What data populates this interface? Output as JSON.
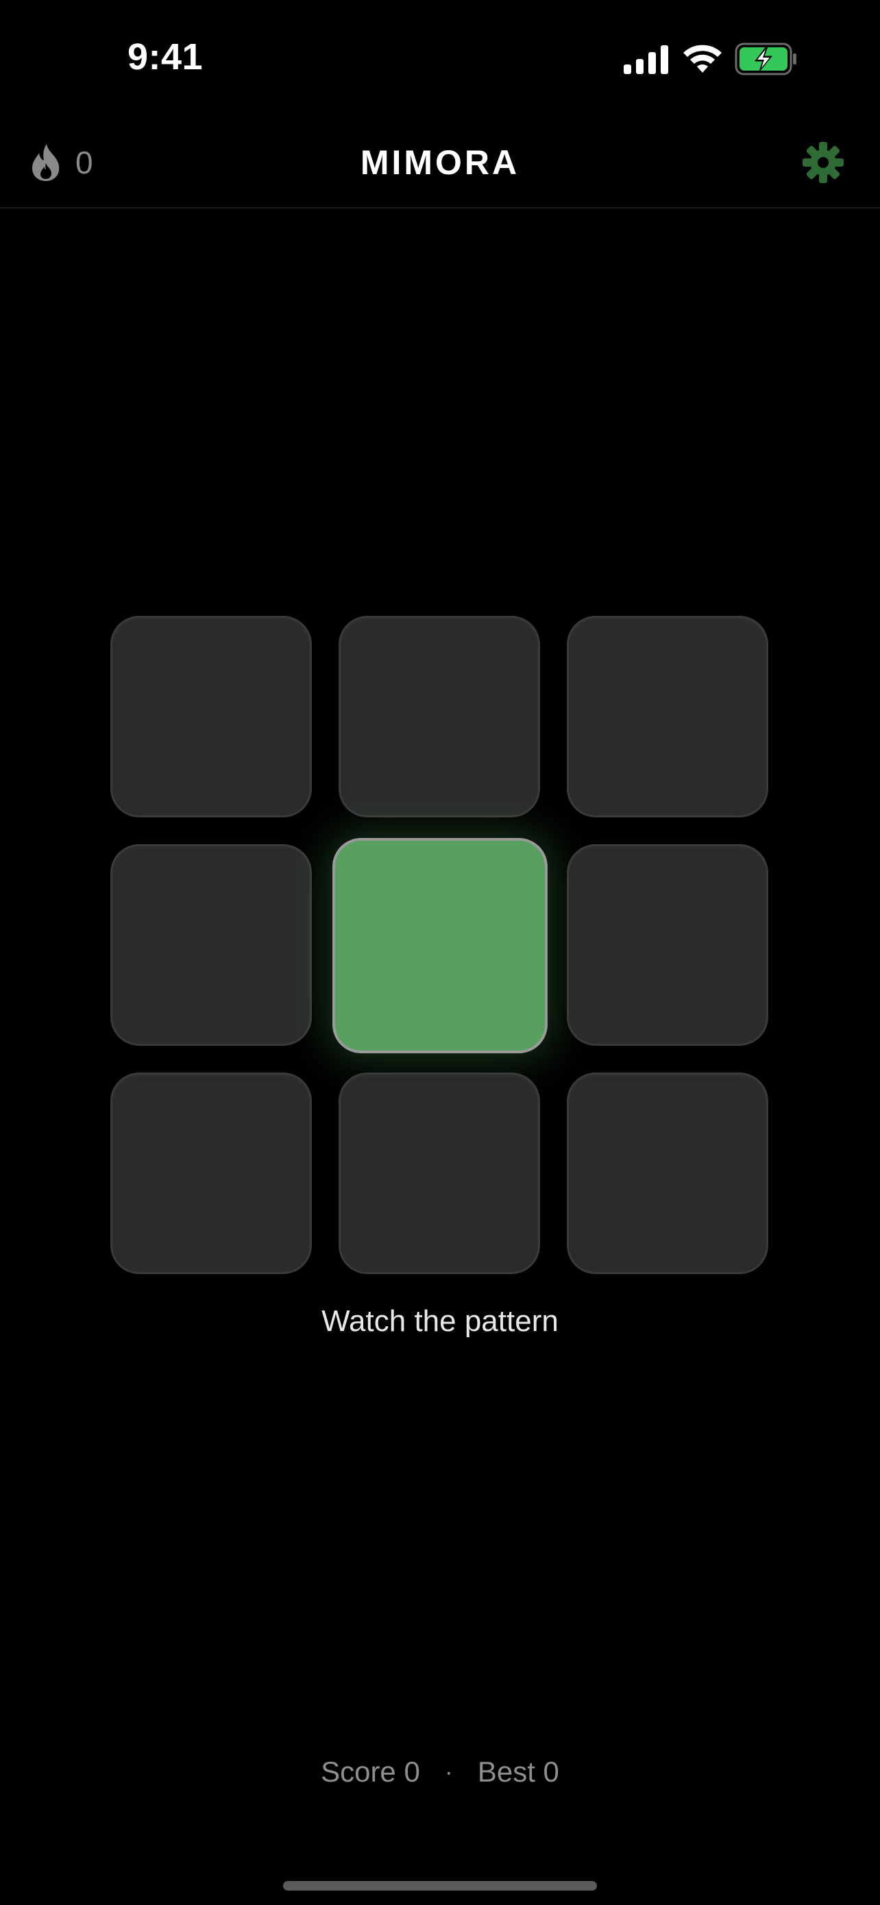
{
  "status_bar": {
    "time": "9:41",
    "icons": [
      "signal-icon",
      "wifi-icon",
      "battery-charging-icon"
    ],
    "battery_color": "#34c759"
  },
  "header": {
    "streak_icon": "flame-icon",
    "streak_count": "0",
    "title": "MIMORA",
    "settings_icon": "gear-icon",
    "settings_color": "#2f6b35"
  },
  "grid": {
    "rows": 3,
    "cols": 3,
    "lit_tile_index": 4,
    "lit_color": "#58a05f",
    "tile_color": "#2b2b2b"
  },
  "hint": "Watch the pattern",
  "score": {
    "score_label": "Score 0",
    "separator": "·",
    "best_label": "Best 0"
  }
}
